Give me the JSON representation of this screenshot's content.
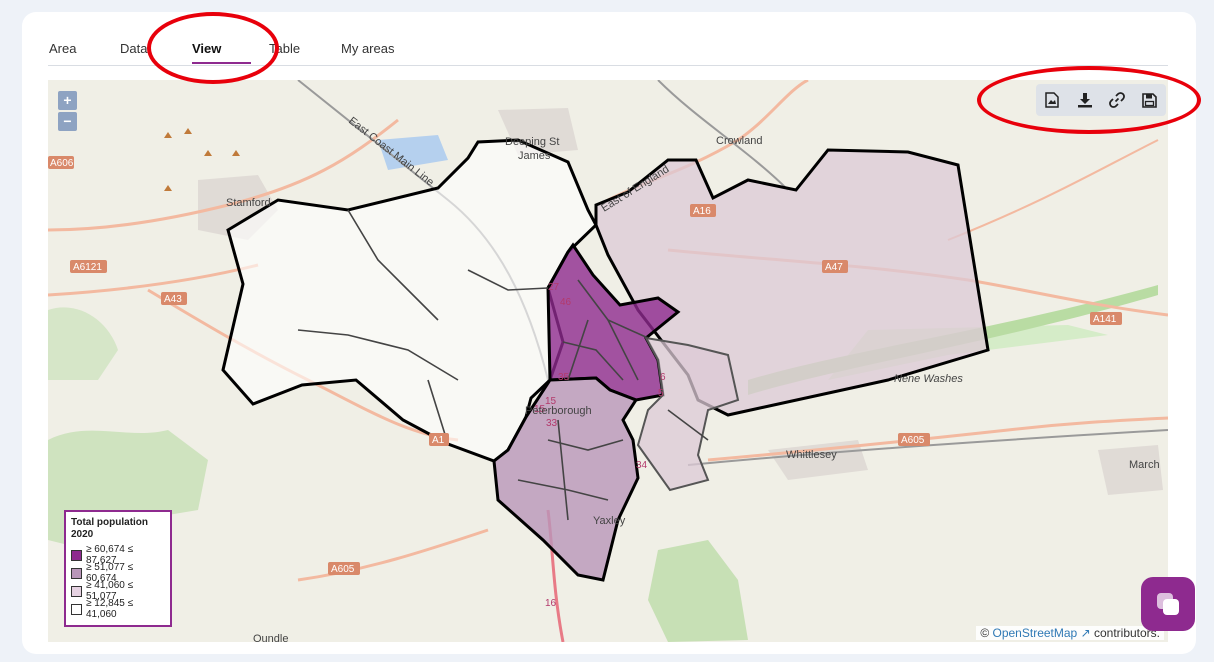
{
  "tabs": [
    {
      "label": "Area"
    },
    {
      "label": "Data"
    },
    {
      "label": "View"
    },
    {
      "label": "Table"
    },
    {
      "label": "My areas"
    }
  ],
  "active_tab": "View",
  "zoom": {
    "in": "+",
    "out": "−"
  },
  "toolbar": {
    "image_icon": "image-file-icon",
    "download_icon": "download-icon",
    "link_icon": "link-icon",
    "save_icon": "save-icon"
  },
  "map_labels": {
    "deeping": "Deeping St",
    "deeping2": "James",
    "crowland": "Crowland",
    "stamford": "Stamford",
    "peterborough": "Peterborough",
    "whittlesey": "Whittlesey",
    "march": "March",
    "yaxley": "Yaxley",
    "nene": "Nene Washes",
    "ecml": "East Coast Main Line",
    "eoe": "East of England",
    "oundle": "Oundle"
  },
  "road_labels": {
    "a606": "A606",
    "a6121": "A6121",
    "a43": "A43",
    "a1": "A1",
    "a16": "A16",
    "a47": "A47",
    "a141": "A141",
    "a605_east": "A605",
    "a605_south": "A605",
    "r16": "16"
  },
  "ward_numbers": [
    "46",
    "27",
    "35",
    "6",
    "5",
    "15",
    "15",
    "33",
    "34"
  ],
  "legend": {
    "title": "Total population 2020",
    "items": [
      {
        "label": "≥ 60,674 ≤ 87,627",
        "color": "#8e2a8f"
      },
      {
        "label": "≥ 51,077 ≤ 60,674",
        "color": "#b996b9"
      },
      {
        "label": "≥ 41,060 ≤ 51,077",
        "color": "#e6d2e2"
      },
      {
        "label": "≥ 12,845 ≤ 41,060",
        "color": "#ffffff"
      }
    ]
  },
  "attribution": {
    "prefix": "©",
    "link": "OpenStreetMap",
    "suffix": "contributors."
  },
  "colors": {
    "accent": "#8e2a8f",
    "annotation": "#e8000b"
  }
}
